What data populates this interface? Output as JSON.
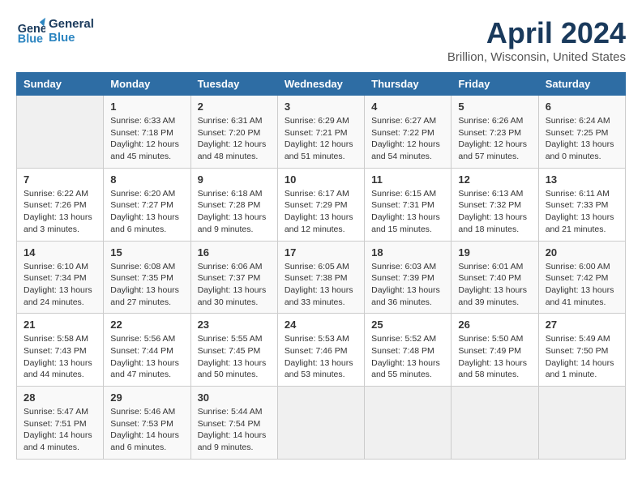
{
  "header": {
    "logo_line1": "General",
    "logo_line2": "Blue",
    "title": "April 2024",
    "subtitle": "Brillion, Wisconsin, United States"
  },
  "days_of_week": [
    "Sunday",
    "Monday",
    "Tuesday",
    "Wednesday",
    "Thursday",
    "Friday",
    "Saturday"
  ],
  "weeks": [
    [
      {
        "day": "",
        "info": ""
      },
      {
        "day": "1",
        "info": "Sunrise: 6:33 AM\nSunset: 7:18 PM\nDaylight: 12 hours\nand 45 minutes."
      },
      {
        "day": "2",
        "info": "Sunrise: 6:31 AM\nSunset: 7:20 PM\nDaylight: 12 hours\nand 48 minutes."
      },
      {
        "day": "3",
        "info": "Sunrise: 6:29 AM\nSunset: 7:21 PM\nDaylight: 12 hours\nand 51 minutes."
      },
      {
        "day": "4",
        "info": "Sunrise: 6:27 AM\nSunset: 7:22 PM\nDaylight: 12 hours\nand 54 minutes."
      },
      {
        "day": "5",
        "info": "Sunrise: 6:26 AM\nSunset: 7:23 PM\nDaylight: 12 hours\nand 57 minutes."
      },
      {
        "day": "6",
        "info": "Sunrise: 6:24 AM\nSunset: 7:25 PM\nDaylight: 13 hours\nand 0 minutes."
      }
    ],
    [
      {
        "day": "7",
        "info": "Sunrise: 6:22 AM\nSunset: 7:26 PM\nDaylight: 13 hours\nand 3 minutes."
      },
      {
        "day": "8",
        "info": "Sunrise: 6:20 AM\nSunset: 7:27 PM\nDaylight: 13 hours\nand 6 minutes."
      },
      {
        "day": "9",
        "info": "Sunrise: 6:18 AM\nSunset: 7:28 PM\nDaylight: 13 hours\nand 9 minutes."
      },
      {
        "day": "10",
        "info": "Sunrise: 6:17 AM\nSunset: 7:29 PM\nDaylight: 13 hours\nand 12 minutes."
      },
      {
        "day": "11",
        "info": "Sunrise: 6:15 AM\nSunset: 7:31 PM\nDaylight: 13 hours\nand 15 minutes."
      },
      {
        "day": "12",
        "info": "Sunrise: 6:13 AM\nSunset: 7:32 PM\nDaylight: 13 hours\nand 18 minutes."
      },
      {
        "day": "13",
        "info": "Sunrise: 6:11 AM\nSunset: 7:33 PM\nDaylight: 13 hours\nand 21 minutes."
      }
    ],
    [
      {
        "day": "14",
        "info": "Sunrise: 6:10 AM\nSunset: 7:34 PM\nDaylight: 13 hours\nand 24 minutes."
      },
      {
        "day": "15",
        "info": "Sunrise: 6:08 AM\nSunset: 7:35 PM\nDaylight: 13 hours\nand 27 minutes."
      },
      {
        "day": "16",
        "info": "Sunrise: 6:06 AM\nSunset: 7:37 PM\nDaylight: 13 hours\nand 30 minutes."
      },
      {
        "day": "17",
        "info": "Sunrise: 6:05 AM\nSunset: 7:38 PM\nDaylight: 13 hours\nand 33 minutes."
      },
      {
        "day": "18",
        "info": "Sunrise: 6:03 AM\nSunset: 7:39 PM\nDaylight: 13 hours\nand 36 minutes."
      },
      {
        "day": "19",
        "info": "Sunrise: 6:01 AM\nSunset: 7:40 PM\nDaylight: 13 hours\nand 39 minutes."
      },
      {
        "day": "20",
        "info": "Sunrise: 6:00 AM\nSunset: 7:42 PM\nDaylight: 13 hours\nand 41 minutes."
      }
    ],
    [
      {
        "day": "21",
        "info": "Sunrise: 5:58 AM\nSunset: 7:43 PM\nDaylight: 13 hours\nand 44 minutes."
      },
      {
        "day": "22",
        "info": "Sunrise: 5:56 AM\nSunset: 7:44 PM\nDaylight: 13 hours\nand 47 minutes."
      },
      {
        "day": "23",
        "info": "Sunrise: 5:55 AM\nSunset: 7:45 PM\nDaylight: 13 hours\nand 50 minutes."
      },
      {
        "day": "24",
        "info": "Sunrise: 5:53 AM\nSunset: 7:46 PM\nDaylight: 13 hours\nand 53 minutes."
      },
      {
        "day": "25",
        "info": "Sunrise: 5:52 AM\nSunset: 7:48 PM\nDaylight: 13 hours\nand 55 minutes."
      },
      {
        "day": "26",
        "info": "Sunrise: 5:50 AM\nSunset: 7:49 PM\nDaylight: 13 hours\nand 58 minutes."
      },
      {
        "day": "27",
        "info": "Sunrise: 5:49 AM\nSunset: 7:50 PM\nDaylight: 14 hours\nand 1 minute."
      }
    ],
    [
      {
        "day": "28",
        "info": "Sunrise: 5:47 AM\nSunset: 7:51 PM\nDaylight: 14 hours\nand 4 minutes."
      },
      {
        "day": "29",
        "info": "Sunrise: 5:46 AM\nSunset: 7:53 PM\nDaylight: 14 hours\nand 6 minutes."
      },
      {
        "day": "30",
        "info": "Sunrise: 5:44 AM\nSunset: 7:54 PM\nDaylight: 14 hours\nand 9 minutes."
      },
      {
        "day": "",
        "info": ""
      },
      {
        "day": "",
        "info": ""
      },
      {
        "day": "",
        "info": ""
      },
      {
        "day": "",
        "info": ""
      }
    ]
  ]
}
